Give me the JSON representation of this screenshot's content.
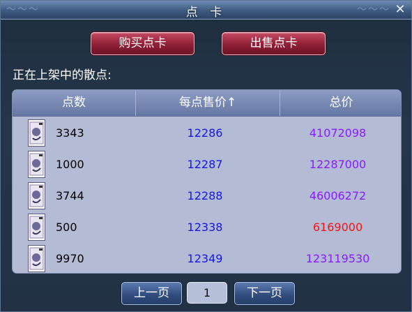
{
  "window": {
    "title": "点 卡",
    "close_symbol": "✕"
  },
  "actions": {
    "buy_label": "购买点卡",
    "sell_label": "出售点卡"
  },
  "section_label": "正在上架中的散点:",
  "table": {
    "headers": {
      "qty": "点数",
      "unit_price": "每点售价↑",
      "total": "总价"
    },
    "rows": [
      {
        "qty": "3343",
        "unit_price": "12286",
        "total": "41072098",
        "total_color": "#8a1bff"
      },
      {
        "qty": "1000",
        "unit_price": "12287",
        "total": "12287000",
        "total_color": "#8a1bff"
      },
      {
        "qty": "3744",
        "unit_price": "12288",
        "total": "46006272",
        "total_color": "#8a1bff"
      },
      {
        "qty": "500",
        "unit_price": "12338",
        "total": "6169000",
        "total_color": "#ff1010"
      },
      {
        "qty": "9970",
        "unit_price": "12349",
        "total": "123119530",
        "total_color": "#8a1bff"
      }
    ],
    "row_icon": "point-card-icon"
  },
  "pager": {
    "prev_label": "上一页",
    "page": "1",
    "next_label": "下一页"
  },
  "colors": {
    "accent_buy_sell": "#8e1e35",
    "unit_price": "#1515e8",
    "total": "#8a1bff",
    "total_alert": "#ff1010"
  }
}
